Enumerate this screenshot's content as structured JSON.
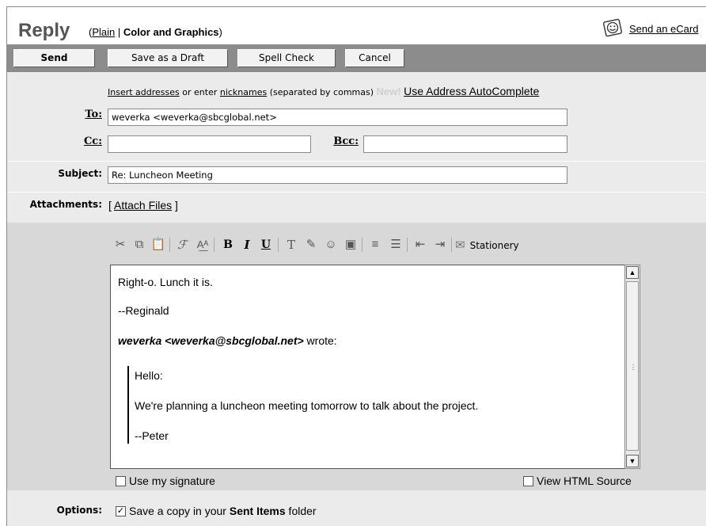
{
  "header": {
    "title": "Reply",
    "mode_open": "(",
    "mode_plain": "Plain",
    "mode_sep": "|",
    "mode_color": "Color and Graphics",
    "mode_close": ")",
    "ecard_label": "Send an eCard"
  },
  "toolbar": {
    "send": "Send",
    "save_draft": "Save as a Draft",
    "spell_check": "Spell Check",
    "cancel": "Cancel"
  },
  "addressing": {
    "insert_addresses": "Insert addresses",
    "or_enter": " or enter ",
    "nicknames": "nicknames",
    "separated": " (separated by commas) ",
    "new_badge": "New!",
    "autocomplete": "Use Address AutoComplete",
    "to_label": "To:",
    "to_value": "weverka <weverka@sbcglobal.net>",
    "cc_label": "Cc:",
    "cc_value": "",
    "bcc_label": "Bcc:",
    "bcc_value": ""
  },
  "subject": {
    "label": "Subject:",
    "value": "Re: Luncheon Meeting"
  },
  "attachments": {
    "label": "Attachments:",
    "open": "[",
    "link": "Attach Files",
    "close": "]"
  },
  "editor": {
    "stationery_label": "Stationery",
    "icons": {
      "cut": "cut-icon",
      "copy": "copy-icon",
      "paste": "paste-icon",
      "font": "font-icon",
      "font_size": "font-size-icon",
      "bold": "B",
      "italic": "I",
      "underline": "U",
      "text_color": "text-color-icon",
      "highlight": "highlight-icon",
      "emoticon": "emoticon-icon",
      "image": "image-icon",
      "align": "align-icon",
      "list": "bullet-list-icon",
      "outdent": "outdent-icon",
      "indent": "indent-icon",
      "stationery": "stationery-icon"
    },
    "body": {
      "line1": "Right-o. Lunch it is.",
      "line2": "--Reginald",
      "quote_author": "weverka <weverka@sbcglobal.net>",
      "wrote": " wrote:",
      "quote_line1": "Hello:",
      "quote_line2": "We're planning a luncheon meeting tomorrow to talk about the project.",
      "quote_line3": "--Peter"
    },
    "use_signature": {
      "label": "Use my signature",
      "checked": false
    },
    "view_html_source": {
      "label": "View HTML Source",
      "checked": false
    }
  },
  "options": {
    "label": "Options:",
    "save_copy_pre": "Save a copy in your ",
    "save_copy_bold": "Sent Items",
    "save_copy_post": " folder",
    "save_copy_checked": true,
    "check_mark": "✓"
  }
}
